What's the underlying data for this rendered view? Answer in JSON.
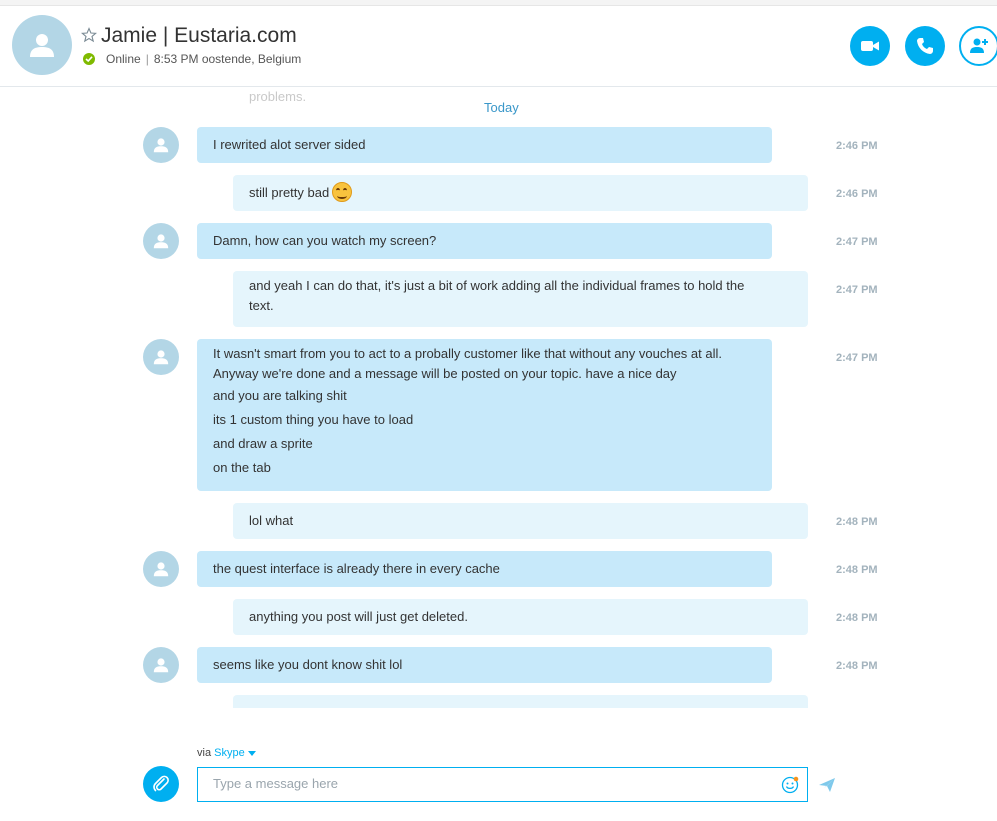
{
  "header": {
    "contact_name": "Jamie | Eustaria.com",
    "status": "Online",
    "local_time": "8:53 PM oostende, Belgium",
    "separator": "|",
    "buttons": {
      "video": "video-call-icon",
      "call": "call-icon",
      "add": "add-contact-icon"
    }
  },
  "conversation": {
    "faded_text": "problems.",
    "date_divider": "Today",
    "messages": [
      {
        "side": "in",
        "lines": [
          "I rewrited alot server sided"
        ],
        "time": "2:46 PM"
      },
      {
        "side": "out",
        "lines": [
          "still pretty bad"
        ],
        "emoji": "grin-emoji",
        "time": "2:46 PM"
      },
      {
        "side": "in",
        "lines": [
          "Damn, how can you watch my screen?"
        ],
        "time": "2:47 PM"
      },
      {
        "side": "out",
        "lines": [
          "and yeah I can do that, it's just a bit of work adding all the individual frames to hold the",
          "text."
        ],
        "time": "2:47 PM"
      },
      {
        "side": "in",
        "lines": [
          "It wasn't smart from you to act to a probally customer like that without any vouches at all.",
          "Anyway we're done and a message will be posted on your topic. have a nice day",
          "and you are talking shit",
          "its 1 custom thing you have to load",
          "and draw a sprite",
          "on the tab"
        ],
        "time": "2:47 PM"
      },
      {
        "side": "out",
        "lines": [
          "lol what"
        ],
        "time": "2:48 PM"
      },
      {
        "side": "in",
        "lines": [
          "the quest interface is already there in every cache"
        ],
        "time": "2:48 PM"
      },
      {
        "side": "out",
        "lines": [
          "anything you post will just get deleted."
        ],
        "time": "2:48 PM"
      },
      {
        "side": "in",
        "lines": [
          "seems like you dont know shit lol"
        ],
        "time": "2:48 PM"
      }
    ]
  },
  "composer": {
    "via_label": "via",
    "via_service": "Skype",
    "placeholder": "Type a message here",
    "value": ""
  },
  "colors": {
    "accent": "#00aff0",
    "incoming_bubble": "#c7e9fa",
    "outgoing_bubble": "#e5f5fc",
    "online": "#7fba00",
    "avatar_bg": "#b3d6e6"
  }
}
